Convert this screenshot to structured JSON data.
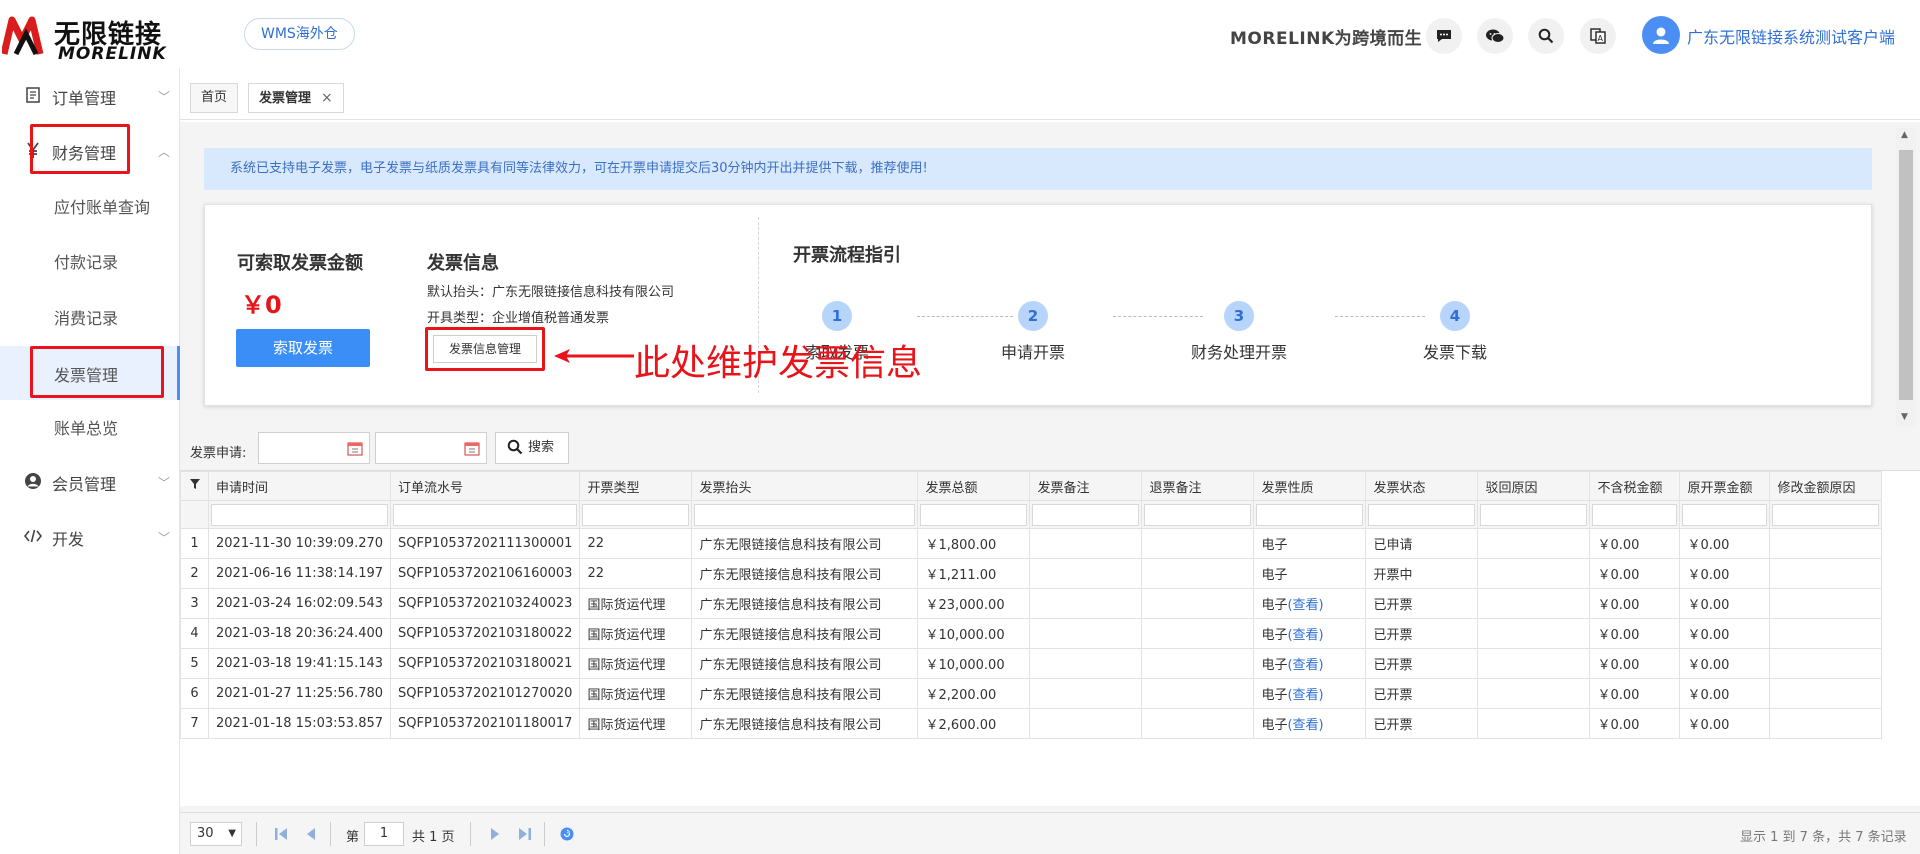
{
  "header": {
    "logo_cn": "无限链接",
    "logo_en": "MORELINK",
    "warehouse_button": "WMS海外仓",
    "slogan": "MORELINK为跨境而生",
    "username": "广东无限链接系统测试客户端",
    "icons": [
      "chat-icon",
      "wechat-icon",
      "search-icon",
      "translate-icon",
      "user-avatar-icon"
    ]
  },
  "sidebar": {
    "items": [
      {
        "label": "订单管理",
        "icon": "document-icon",
        "chevron": "down"
      },
      {
        "label": "财务管理",
        "icon": "yen-icon",
        "chevron": "up"
      },
      {
        "label": "应付账单查询"
      },
      {
        "label": "付款记录"
      },
      {
        "label": "消费记录"
      },
      {
        "label": "发票管理",
        "active": true
      },
      {
        "label": "账单总览"
      },
      {
        "label": "会员管理",
        "icon": "person-icon",
        "chevron": "down"
      },
      {
        "label": "开发",
        "icon": "code-icon",
        "chevron": "down"
      }
    ]
  },
  "tabs": [
    {
      "label": "首页"
    },
    {
      "label": "发票管理",
      "active": true,
      "closable": "×"
    }
  ],
  "notice": "系统已支持电子发票，电子发票与纸质发票具有同等法律效力，可在开票申请提交后30分钟内开出并提供下载，推荐使用!",
  "card": {
    "amount_title": "可索取发票金额",
    "amount_value": "￥0",
    "request_button": "索取发票",
    "info_title": "发票信息",
    "default_header": "默认抬头：广东无限链接信息科技有限公司",
    "invoice_type": "开具类型：企业增值税普通发票",
    "manage_button": "发票信息管理",
    "flow_title": "开票流程指引",
    "steps": [
      {
        "num": "1",
        "label": "索取发票"
      },
      {
        "num": "2",
        "label": "申请开票"
      },
      {
        "num": "3",
        "label": "财务处理开票"
      },
      {
        "num": "4",
        "label": "发票下载"
      }
    ]
  },
  "annotation": "此处维护发票信息",
  "search": {
    "label": "发票申请:",
    "button": "搜索",
    "date_from": "",
    "date_to": ""
  },
  "table": {
    "columns": [
      "申请时间",
      "订单流水号",
      "开票类型",
      "发票抬头",
      "发票总额",
      "发票备注",
      "退票备注",
      "发票性质",
      "发票状态",
      "驳回原因",
      "不含税金额",
      "原开票金额",
      "修改金额原因"
    ],
    "rows": [
      {
        "n": "1",
        "time": "2021-11-30 10:39:09.270",
        "serial": "SQFP10537202111300001",
        "type": "22",
        "title": "广东无限链接信息科技有限公司",
        "total": "￥1,800.00",
        "remark": "",
        "refund": "",
        "nature": "电子",
        "view": "",
        "status": "已申请",
        "reject": "",
        "untaxed": "￥0.00",
        "orig": "￥0.00",
        "reason": ""
      },
      {
        "n": "2",
        "time": "2021-06-16 11:38:14.197",
        "serial": "SQFP10537202106160003",
        "type": "22",
        "title": "广东无限链接信息科技有限公司",
        "total": "￥1,211.00",
        "remark": "",
        "refund": "",
        "nature": "电子",
        "view": "",
        "status": "开票中",
        "reject": "",
        "untaxed": "￥0.00",
        "orig": "￥0.00",
        "reason": ""
      },
      {
        "n": "3",
        "time": "2021-03-24 16:02:09.543",
        "serial": "SQFP10537202103240023",
        "type": "国际货运代理",
        "title": "广东无限链接信息科技有限公司",
        "total": "￥23,000.00",
        "remark": "",
        "refund": "",
        "nature": "电子",
        "view": "(查看)",
        "status": "已开票",
        "reject": "",
        "untaxed": "￥0.00",
        "orig": "￥0.00",
        "reason": ""
      },
      {
        "n": "4",
        "time": "2021-03-18 20:36:24.400",
        "serial": "SQFP10537202103180022",
        "type": "国际货运代理",
        "title": "广东无限链接信息科技有限公司",
        "total": "￥10,000.00",
        "remark": "",
        "refund": "",
        "nature": "电子",
        "view": "(查看)",
        "status": "已开票",
        "reject": "",
        "untaxed": "￥0.00",
        "orig": "￥0.00",
        "reason": ""
      },
      {
        "n": "5",
        "time": "2021-03-18 19:41:15.143",
        "serial": "SQFP10537202103180021",
        "type": "国际货运代理",
        "title": "广东无限链接信息科技有限公司",
        "total": "￥10,000.00",
        "remark": "",
        "refund": "",
        "nature": "电子",
        "view": "(查看)",
        "status": "已开票",
        "reject": "",
        "untaxed": "￥0.00",
        "orig": "￥0.00",
        "reason": ""
      },
      {
        "n": "6",
        "time": "2021-01-27 11:25:56.780",
        "serial": "SQFP10537202101270020",
        "type": "国际货运代理",
        "title": "广东无限链接信息科技有限公司",
        "total": "￥2,200.00",
        "remark": "",
        "refund": "",
        "nature": "电子",
        "view": "(查看)",
        "status": "已开票",
        "reject": "",
        "untaxed": "￥0.00",
        "orig": "￥0.00",
        "reason": ""
      },
      {
        "n": "7",
        "time": "2021-01-18 15:03:53.857",
        "serial": "SQFP10537202101180017",
        "type": "国际货运代理",
        "title": "广东无限链接信息科技有限公司",
        "total": "￥2,600.00",
        "remark": "",
        "refund": "",
        "nature": "电子",
        "view": "(查看)",
        "status": "已开票",
        "reject": "",
        "untaxed": "￥0.00",
        "orig": "￥0.00",
        "reason": ""
      }
    ]
  },
  "pager": {
    "page_size": "30",
    "page_label": "第",
    "page_value": "1",
    "total_pages": "共 1 页",
    "summary": "显示 1 到 7 条，共 7 条记录"
  },
  "colors": {
    "accent": "#3a8ef6",
    "annotation": "#e8141a",
    "notice_bg": "#d9e9fd",
    "link": "#2f6fd6"
  }
}
